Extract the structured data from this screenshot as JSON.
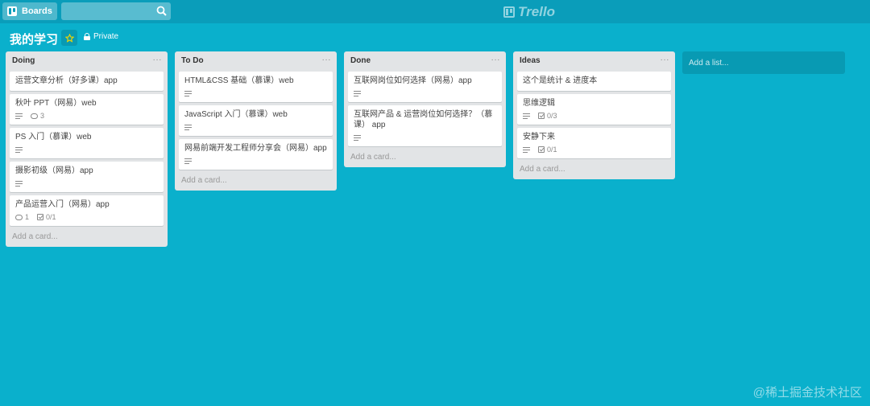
{
  "topbar": {
    "boards_label": "Boards",
    "search": {
      "value": "",
      "placeholder": ""
    },
    "logo_text": "Trello"
  },
  "board": {
    "title": "我的学习",
    "visibility": "Private"
  },
  "lists": [
    {
      "title": "Doing",
      "menu": "···",
      "cards": [
        {
          "title": "运营文章分析（好多课）app"
        },
        {
          "title": "秋叶 PPT（网易）web",
          "desc": true,
          "comments": "3"
        },
        {
          "title": "PS 入门（慕课）web",
          "desc": true
        },
        {
          "title": "摄影初级（网易）app",
          "desc": true
        },
        {
          "title": "产品运营入门（网易）app",
          "comments": "1",
          "checklist": "0/1"
        }
      ],
      "add_card": "Add a card..."
    },
    {
      "title": "To Do",
      "menu": "···",
      "cards": [
        {
          "title": "HTML&CSS 基础（慕课）web",
          "desc": true
        },
        {
          "title": "JavaScript 入门（慕课）web",
          "desc": true
        },
        {
          "title": "网易前端开发工程师分享会（网易）app",
          "desc": true
        }
      ],
      "add_card": "Add a card..."
    },
    {
      "title": "Done",
      "menu": "···",
      "cards": [
        {
          "title": "互联网岗位如何选择（网易）app",
          "desc": true
        },
        {
          "title": "互联网产品 & 运营岗位如何选择？（慕课） app",
          "desc": true
        }
      ],
      "add_card": "Add a card..."
    },
    {
      "title": "Ideas",
      "menu": "···",
      "cards": [
        {
          "title": "这个是统计 & 进度本"
        },
        {
          "title": "思维逻辑",
          "desc": true,
          "checklist": "0/3"
        },
        {
          "title": "安静下来",
          "desc": true,
          "checklist": "0/1"
        }
      ],
      "add_card": "Add a card..."
    }
  ],
  "add_list_label": "Add a list...",
  "watermark": "@稀土掘金技术社区",
  "colors": {
    "background": "#0ab0cc",
    "topbar": "#0a9dba",
    "list": "#e2e4e6"
  }
}
